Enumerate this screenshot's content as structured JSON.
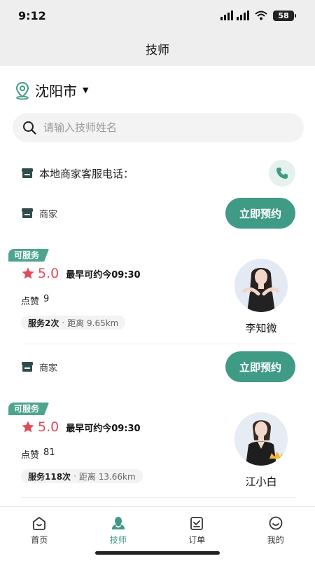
{
  "status_bar": {
    "time": "9:12",
    "battery": "58"
  },
  "nav": {
    "title": "技师"
  },
  "location": {
    "city": "沈阳市"
  },
  "search": {
    "placeholder": "请输入技师姓名"
  },
  "service": {
    "label": "本地商家客服电话："
  },
  "merchant": {
    "label": "商家",
    "book_label": "立即预约"
  },
  "technicians": [
    {
      "badge": "可服务",
      "rating": "5.0",
      "earliest": "最早可约今09:30",
      "likes_label": "点赞",
      "likes": "9",
      "served": "服务2次",
      "distance": "距离 9.65km",
      "name": "李知微"
    },
    {
      "badge": "可服务",
      "rating": "5.0",
      "earliest": "最早可约今09:30",
      "likes_label": "点赞",
      "likes": "81",
      "served": "服务118次",
      "distance": "距离 13.66km",
      "name": "江小白"
    }
  ],
  "tabs": [
    {
      "label": "首页",
      "icon": "home-icon"
    },
    {
      "label": "技师",
      "icon": "technician-icon",
      "active": true
    },
    {
      "label": "订单",
      "icon": "order-icon"
    },
    {
      "label": "我的",
      "icon": "profile-icon"
    }
  ],
  "colors": {
    "accent": "#3f9a86",
    "rating": "#e24b5a",
    "badge": "#4ea48f"
  }
}
